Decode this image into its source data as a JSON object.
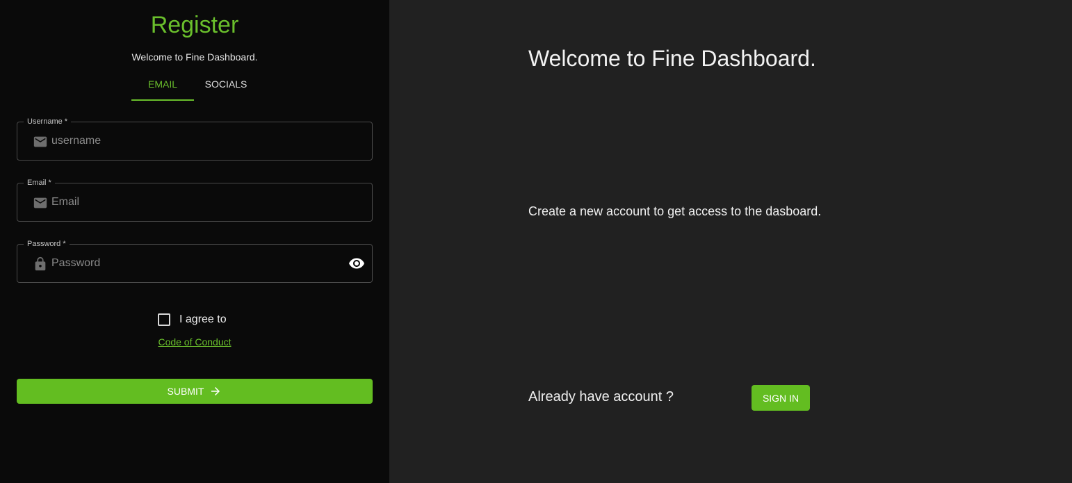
{
  "register": {
    "title": "Register",
    "subtitle": "Welcome to Fine Dashboard.",
    "tabs": [
      {
        "label": "EMAIL",
        "active": true
      },
      {
        "label": "SOCIALS",
        "active": false
      }
    ],
    "fields": {
      "username": {
        "label": "Username *",
        "placeholder": "username",
        "icon": "mail-icon"
      },
      "email": {
        "label": "Email *",
        "placeholder": "Email",
        "icon": "mail-icon"
      },
      "password": {
        "label": "Password *",
        "placeholder": "Password",
        "icon": "lock-icon",
        "toggle_icon": "eye-icon"
      }
    },
    "agree_label": "I agree to",
    "agree_checked": false,
    "code_of_conduct": "Code of Conduct",
    "submit_label": "SUBMIT"
  },
  "info": {
    "heading": "Welcome to Fine Dashboard.",
    "description": "Create a new account to get access to the dasboard.",
    "already_label": "Already have account ?",
    "signin_label": "SIGN IN"
  },
  "colors": {
    "accent": "#63bd21",
    "accent_text": "#6abf2c",
    "left_bg": "#0a0a0a",
    "right_bg": "#212121"
  }
}
